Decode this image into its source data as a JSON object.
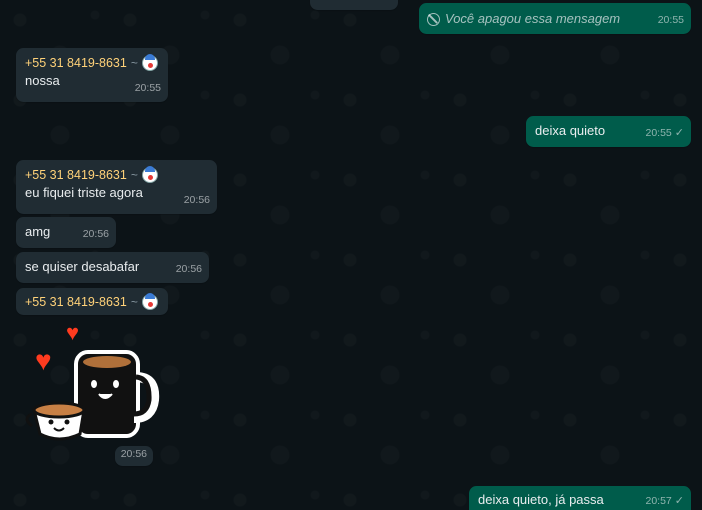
{
  "messages": {
    "top_partial": {},
    "deleted": {
      "text": "Você apagou essa mensagem",
      "time": "20:55"
    },
    "m1": {
      "sender": "+55 31 8419-8631",
      "text": "nossa",
      "time": "20:55"
    },
    "m2": {
      "text": "deixa quieto",
      "time": "20:55"
    },
    "m3": {
      "sender": "+55 31 8419-8631",
      "text": "eu fiquei triste agora",
      "time": "20:56"
    },
    "m4": {
      "text": "amg",
      "time": "20:56"
    },
    "m5": {
      "text": "se quiser desabafar",
      "time": "20:56"
    },
    "m6": {
      "sender": "+55 31 8419-8631",
      "sticker": "coffee-cups-hearts-sticker",
      "time": "20:56"
    },
    "m7": {
      "text": "deixa quieto, já passa",
      "time": "20:57"
    }
  },
  "tilde": "~",
  "colors": {
    "background": "#0b141a",
    "incoming_bubble": "#202c33",
    "outgoing_bubble": "#005c4b",
    "sender_name": "#ffd279"
  }
}
